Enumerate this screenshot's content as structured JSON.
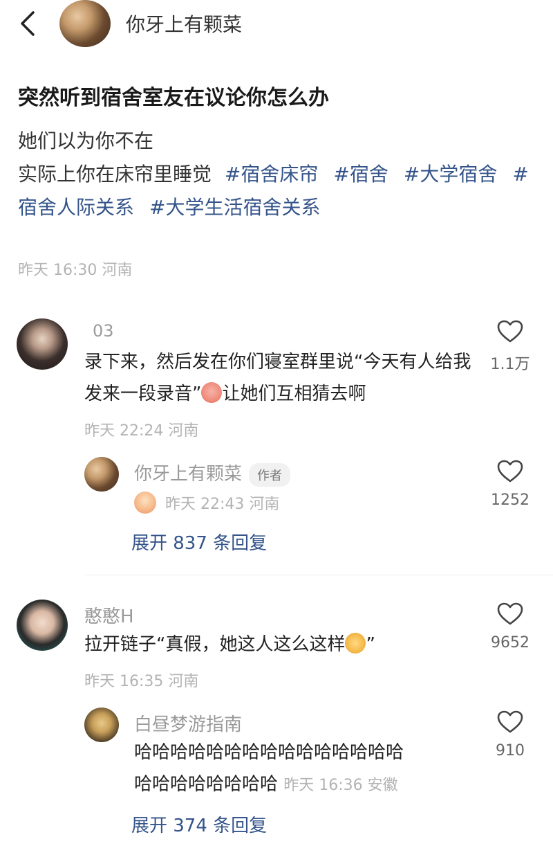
{
  "header": {
    "author_name": "你牙上有颗菜"
  },
  "post": {
    "title": "突然听到宿舍室友在议论你怎么办",
    "line1": "她们以为你不在",
    "line2": "实际上你在床帘里睡觉",
    "tags": [
      "#宿舍床帘",
      "#宿舍",
      "#大学宿舍",
      "#宿舍人际关系",
      "#大学生活宿舍关系"
    ],
    "meta": "昨天 16:30 河南"
  },
  "comments": [
    {
      "user": "03",
      "text_a": "录下来，然后发在你们寝室群里说“今天有人给我发来一段录音”",
      "text_b": "让她们互相猜去啊",
      "meta": "昨天 22:24 河南",
      "likes": "1.1万",
      "reply": {
        "user": "你牙上有颗菜",
        "badge": "作者",
        "meta": "昨天 22:43 河南",
        "likes": "1252"
      },
      "expand": "展开 837 条回复"
    },
    {
      "user": "憨憨H",
      "text_a": "拉开链子“真假，她这人这么这样",
      "text_b": "”",
      "meta": "昨天 16:35 河南",
      "likes": "9652",
      "reply": {
        "user": "白昼梦游指南",
        "line1": "哈哈哈哈哈哈哈哈哈哈哈哈哈哈哈",
        "line2": "哈哈哈哈哈哈哈哈",
        "meta": "昨天 16:36 安徽",
        "likes": "910"
      },
      "expand": "展开 374 条回复"
    }
  ],
  "colors": {
    "tag": "#34548a",
    "meta": "#b3b3b3",
    "accent_emoji": "#f4b94a"
  },
  "icons": {
    "back": "chevron-left-icon",
    "like": "heart-outline-icon"
  }
}
